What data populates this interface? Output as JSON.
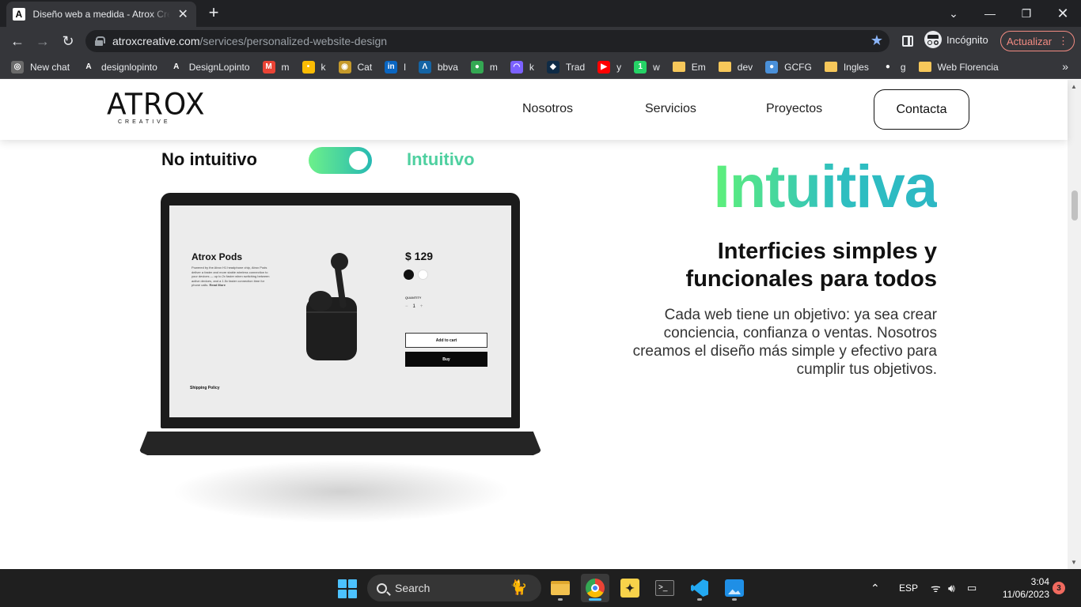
{
  "browser": {
    "tab_title": "Diseño web a medida - Atrox Creative",
    "tab_favicon": "A",
    "url_host": "atroxcreative.com",
    "url_path": "/services/personalized-website-design",
    "incognito_label": "Incógnito",
    "update_label": "Actualizar",
    "bookmarks": [
      {
        "label": "New chat",
        "icon": "chatgpt-icon",
        "color": "#6b6b6b",
        "glyph": "◎"
      },
      {
        "label": "designlopinto",
        "icon": "atrox-icon",
        "color": "#35363a",
        "glyph": "A"
      },
      {
        "label": "DesignLopinto",
        "icon": "atrox-icon",
        "color": "#35363a",
        "glyph": "A"
      },
      {
        "label": "m",
        "icon": "gmail-icon",
        "color": "#ea4335",
        "glyph": "M"
      },
      {
        "label": "k",
        "icon": "keep-icon",
        "color": "#fbbc04",
        "glyph": "•"
      },
      {
        "label": "Cat",
        "icon": "cat-icon",
        "color": "#c69a2b",
        "glyph": "◉"
      },
      {
        "label": "l",
        "icon": "linkedin-icon",
        "color": "#0a66c2",
        "glyph": "in"
      },
      {
        "label": "bbva",
        "icon": "bbva-icon",
        "color": "#1464a5",
        "glyph": "Λ"
      },
      {
        "label": "m",
        "icon": "maps-icon",
        "color": "#34a853",
        "glyph": "●"
      },
      {
        "label": "k",
        "icon": "arc-icon",
        "color": "#7b61ff",
        "glyph": "◠"
      },
      {
        "label": "Trad",
        "icon": "deepl-icon",
        "color": "#0f2b46",
        "glyph": "◆"
      },
      {
        "label": "y",
        "icon": "youtube-icon",
        "color": "#ff0000",
        "glyph": "▶"
      },
      {
        "label": "w",
        "icon": "whatsapp-icon",
        "color": "#25d366",
        "glyph": "1"
      },
      {
        "label": "Em",
        "icon": "folder-icon",
        "color": "#f6c75a",
        "glyph": ""
      },
      {
        "label": "dev",
        "icon": "folder-icon",
        "color": "#f6c75a",
        "glyph": ""
      },
      {
        "label": "GCFG",
        "icon": "gcfg-icon",
        "color": "#4a90d9",
        "glyph": "●"
      },
      {
        "label": "Ingles",
        "icon": "folder-icon",
        "color": "#f6c75a",
        "glyph": ""
      },
      {
        "label": "g",
        "icon": "github-icon",
        "color": "#35363a",
        "glyph": "●"
      },
      {
        "label": "Web Florencia",
        "icon": "folder-icon",
        "color": "#f6c75a",
        "glyph": ""
      }
    ]
  },
  "site": {
    "logo_main": "ATROX",
    "logo_sub": "CREATIVE",
    "nav": [
      "Nosotros",
      "Servicios",
      "Proyectos"
    ],
    "contact_label": "Contacta",
    "toggle": {
      "off_label": "No intuitivo",
      "on_label": "Intuitivo",
      "state": "on"
    },
    "mockup": {
      "product_title": "Atrox Pods",
      "product_desc": "Powered by the Atrox H1 headphone chip, Atrox Pods deliver a faster and more stable wireless connection to your devices — up to 2x faster when switching between active devices, and a 1.5x faster connection time for phone calls.",
      "read_more": "Read More",
      "price": "$ 129",
      "quantity_label": "QUANTITY",
      "qty_minus": "−",
      "qty_value": "1",
      "qty_plus": "+",
      "add_to_cart": "Add to cart",
      "buy": "Buy",
      "shipping_policy": "Shipping Policy",
      "colors": [
        "#111111",
        "#ffffff"
      ]
    },
    "heading": "Intuitiva",
    "subheading": "Interficies simples y funcionales para todos",
    "body": "Cada web tiene un objetivo: ya sea crear conciencia, confianza o ventas. Nosotros creamos el diseño más simple y efectivo para cumplir tus objetivos.",
    "accent_start": "#5ef07a",
    "accent_end": "#2db8c4"
  },
  "taskbar": {
    "search_label": "Search",
    "language": "ESP",
    "time": "3:04",
    "date": "11/06/2023",
    "notifications": "3"
  }
}
